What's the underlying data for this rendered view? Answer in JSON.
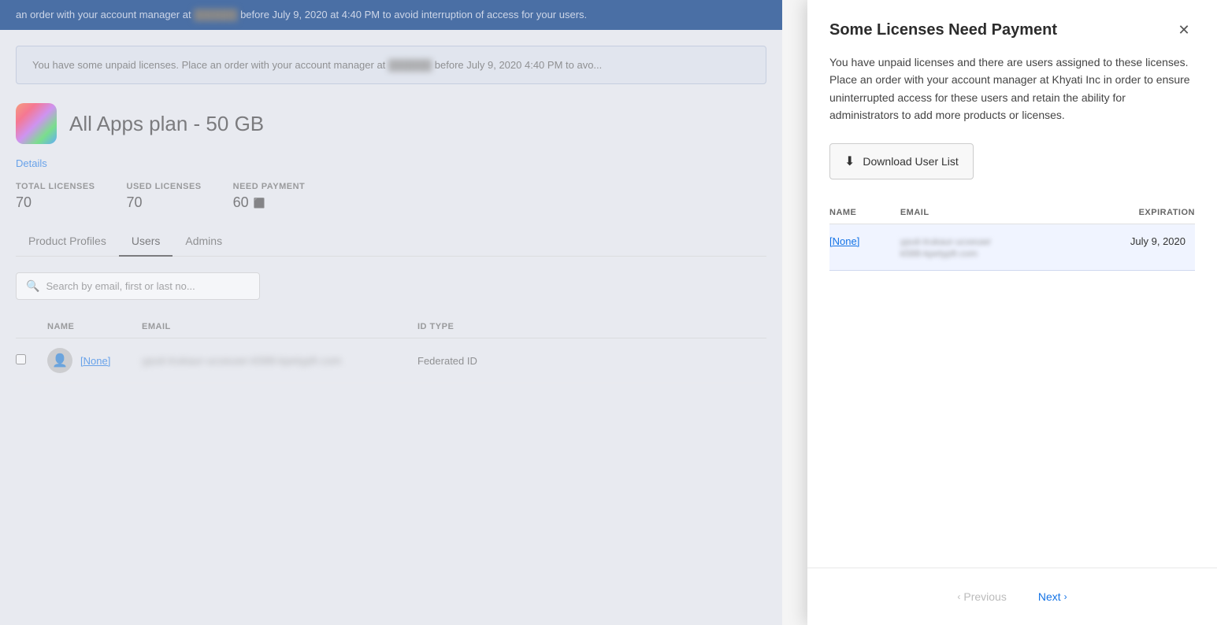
{
  "banner": {
    "text": "an order with your account manager at",
    "company": "Khyati Inc",
    "date_text": "before July 9, 2020 at 4:40 PM to avoid interruption of access for your users."
  },
  "alert": {
    "text": "You have some unpaid licenses. Place an order with your account manager at",
    "company_blurred": "Khyati Inc",
    "date_text": "before July 9, 2020 4:40 PM to avo..."
  },
  "product": {
    "title": "All Apps plan - 50 GB",
    "details_link": "Details"
  },
  "stats": {
    "total_label": "Total Licenses",
    "total_value": "70",
    "used_label": "Used Licenses",
    "used_value": "70",
    "payment_label": "Need Payment",
    "payment_value": "60"
  },
  "tabs": [
    {
      "label": "Product Profiles",
      "active": false
    },
    {
      "label": "Users",
      "active": true
    },
    {
      "label": "Admins",
      "active": false
    }
  ],
  "search": {
    "placeholder": "Search by email, first or last no..."
  },
  "table": {
    "columns": [
      "",
      "Name",
      "Email",
      "ID Type"
    ],
    "rows": [
      {
        "name": "[None]",
        "email_blurred": "yputi-trukaur-ucxeuwr-k588-kpetypfr.com",
        "id_type": "Federated ID"
      }
    ]
  },
  "modal": {
    "title": "Some Licenses Need Payment",
    "description": "You have unpaid licenses and there are users assigned to these licenses. Place an order with your account manager at Khyati Inc in order to ensure uninterrupted access for these users and retain the ability for administrators to add more products or licenses.",
    "download_button": "Download User List",
    "table_columns": {
      "name": "Name",
      "email": "Email",
      "expiration": "Expiration"
    },
    "rows": [
      {
        "name": "[None]",
        "email_blurred": "yputi-trukaur-ucxeuwr\nk588-kpetypfr.com",
        "expiration": "July 9, 2020"
      }
    ],
    "pagination": {
      "previous": "Previous",
      "next": "Next"
    }
  }
}
